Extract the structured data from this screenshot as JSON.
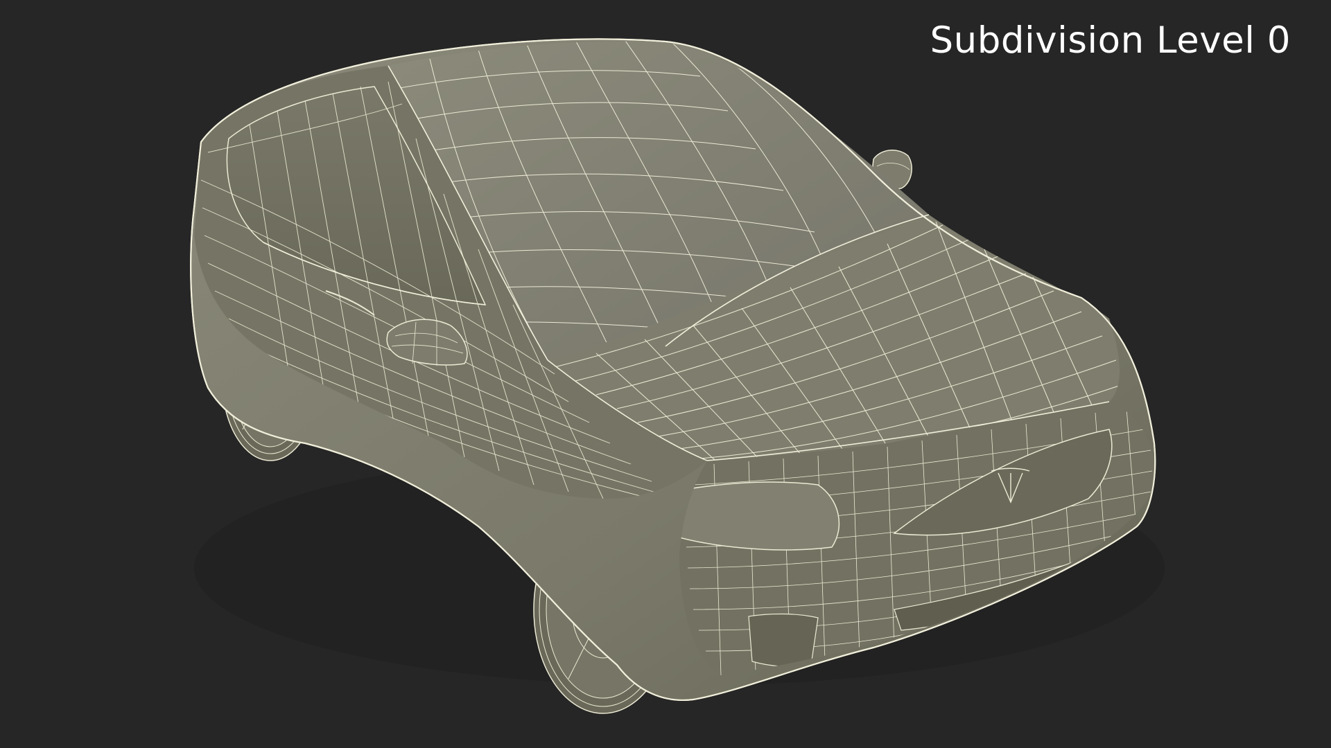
{
  "viewport": {
    "background_color": "#262626",
    "label": "Subdivision Level 0"
  },
  "model": {
    "surface_color": "#7d7c6b",
    "wire_color": "#ecead5",
    "shadow_color": "#5d5c4e"
  }
}
